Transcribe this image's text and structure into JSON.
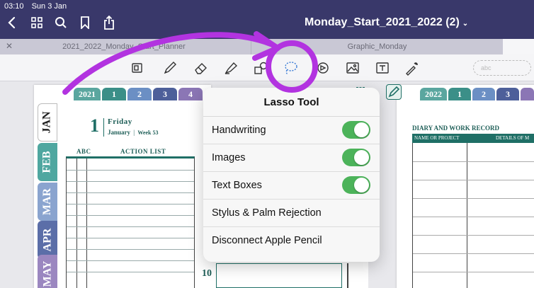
{
  "status": {
    "time": "03:10",
    "date": "Sun 3 Jan"
  },
  "header": {
    "title": "Monday_Start_2021_2022 (2)"
  },
  "tabs": [
    {
      "label": "2021_2022_Monday_Start_Planner"
    },
    {
      "label": "Graphic_Monday"
    }
  ],
  "toolbar": {
    "tools": [
      "page-icon",
      "pen-icon",
      "eraser-icon",
      "highlighter-icon",
      "shapes-icon",
      "lasso-icon",
      "element-icon",
      "image-icon",
      "text-icon",
      "laser-icon"
    ],
    "pill_text": "abc"
  },
  "planner_left": {
    "year_tab": "2021",
    "number_tabs": [
      "1",
      "2",
      "3",
      "4"
    ],
    "months": [
      "JAN",
      "FEB",
      "MAR",
      "APR",
      "MAY"
    ],
    "day_number": "1",
    "weekday": "Friday",
    "month": "January",
    "week": "Week 53",
    "col_abc": "ABC",
    "col_action": "ACTION LIST",
    "row_number": "10"
  },
  "planner_right": {
    "year_tab": "2022",
    "number_tabs": [
      "1",
      "2",
      "3"
    ],
    "title": "DIARY AND WORK RECORD",
    "col_name": "NAME OR PROJECT",
    "col_details": "DETAILS OF M"
  },
  "popover": {
    "title": "Lasso Tool",
    "toggles": [
      {
        "label": "Handwriting",
        "on": true
      },
      {
        "label": "Images",
        "on": true
      },
      {
        "label": "Text Boxes",
        "on": true
      }
    ],
    "items": [
      {
        "label": "Stylus & Palm Rejection"
      },
      {
        "label": "Disconnect Apple Pencil"
      }
    ]
  },
  "colors": {
    "topbar": "#39386a",
    "toggle_on": "#4cb35a",
    "annotation": "#b233e0",
    "planner_teal": "#1f6f66"
  }
}
